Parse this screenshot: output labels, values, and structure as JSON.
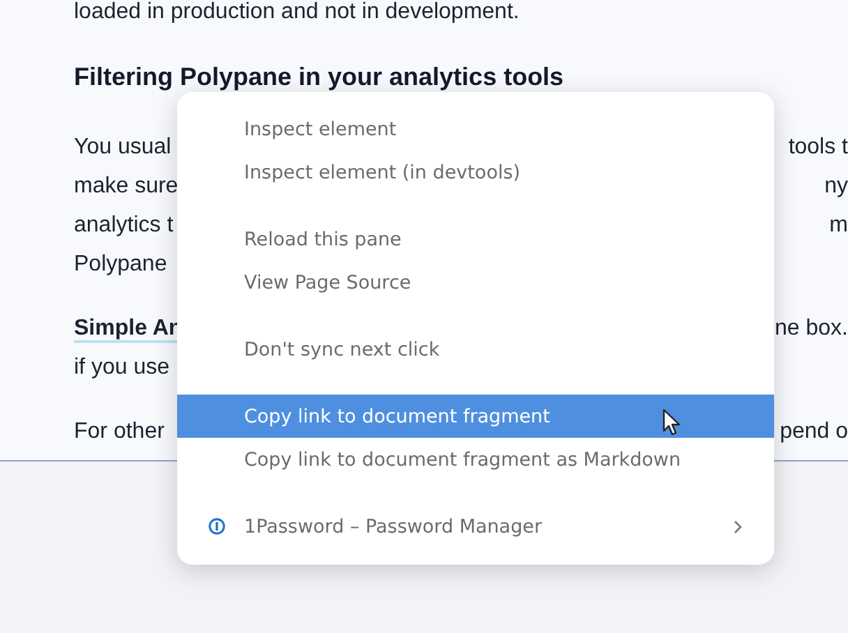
{
  "article": {
    "blocks": [
      {
        "kind": "paragraph",
        "lines": [
          {
            "left": "loaded in production and not in development."
          }
        ]
      },
      {
        "kind": "heading",
        "lines": [
          {
            "left": "Filtering Polypane in your analytics tools"
          }
        ]
      },
      {
        "kind": "paragraph",
        "lines": [
          {
            "left": "You usual",
            "right": "tools t"
          },
          {
            "left": "make sure",
            "right": "ny"
          },
          {
            "left": "analytics t",
            "right": "m"
          },
          {
            "left": "Polypane"
          }
        ]
      },
      {
        "kind": "paragraph",
        "lines": [
          {
            "left": "**Simple An**",
            "right": "ne box."
          },
          {
            "left": "if you use"
          }
        ]
      },
      {
        "kind": "paragraph",
        "lines": [
          {
            "left": "For other",
            "right": "pend o"
          }
        ]
      }
    ]
  },
  "context_menu": {
    "groups": [
      [
        {
          "label": "Inspect element",
          "selected": false,
          "kind": "command",
          "submenu": false
        },
        {
          "label": "Inspect element (in devtools)",
          "selected": false,
          "kind": "command",
          "submenu": false
        }
      ],
      [
        {
          "label": "Reload this pane",
          "selected": false,
          "kind": "command",
          "submenu": false
        },
        {
          "label": "View Page Source",
          "selected": false,
          "kind": "command",
          "submenu": false
        }
      ],
      [
        {
          "label": "Don't sync next click",
          "selected": false,
          "kind": "command",
          "submenu": false
        }
      ],
      [
        {
          "label": "Copy link to document fragment",
          "selected": true,
          "kind": "command",
          "submenu": false
        },
        {
          "label": "Copy link to document fragment as Markdown",
          "selected": false,
          "kind": "command",
          "submenu": false
        }
      ],
      [
        {
          "label": "1Password – Password Manager",
          "selected": false,
          "kind": "extension",
          "submenu": true
        }
      ]
    ]
  }
}
